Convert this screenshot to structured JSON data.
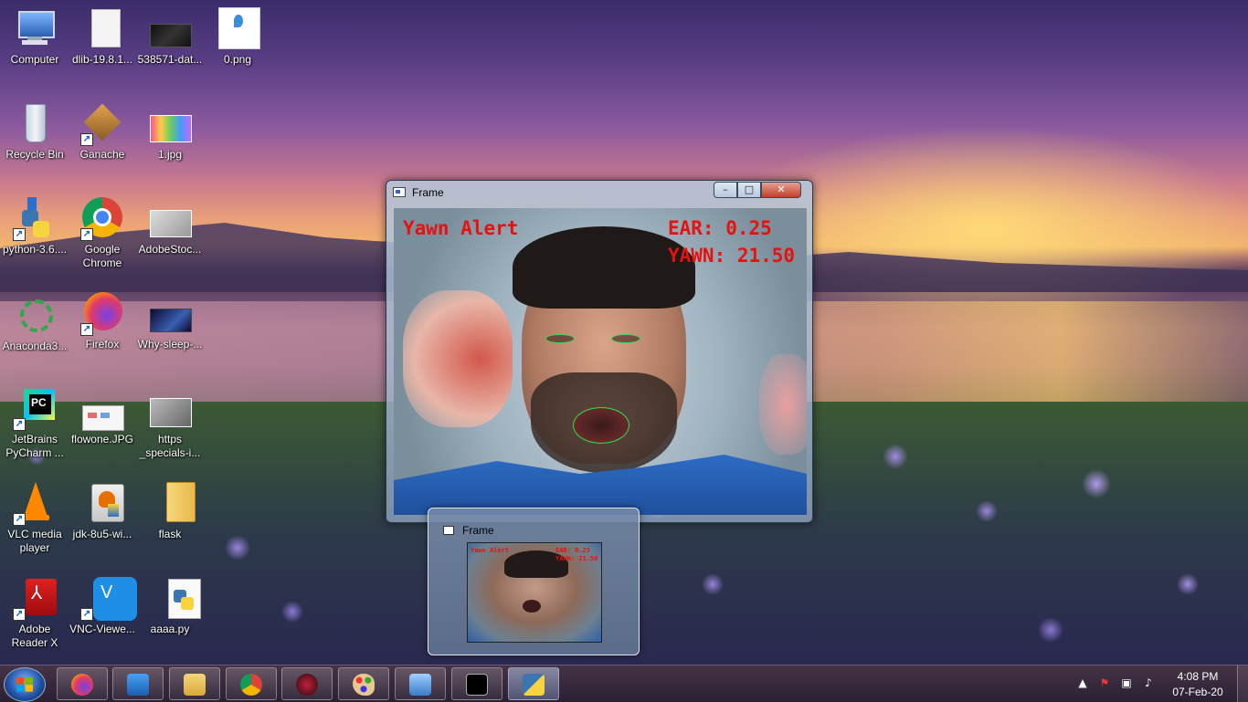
{
  "desktop": {
    "icons": [
      {
        "name": "computer",
        "label": "Computer",
        "icon": "computer-icon"
      },
      {
        "name": "dlib",
        "label": "dlib-19.8.1...",
        "icon": "blank-file-icon"
      },
      {
        "name": "dataset",
        "label": "538571-dat...",
        "icon": "image-file-icon"
      },
      {
        "name": "png0",
        "label": "0.png",
        "icon": "image-file-icon"
      },
      {
        "name": "recycle-bin",
        "label": "Recycle Bin",
        "icon": "recycle-bin-icon"
      },
      {
        "name": "ganache",
        "label": "Ganache",
        "icon": "ganache-icon"
      },
      {
        "name": "jpg1",
        "label": "1.jpg",
        "icon": "image-file-icon"
      },
      {
        "name": "python-installer",
        "label": "python-3.6....",
        "icon": "python-installer-icon"
      },
      {
        "name": "google-chrome",
        "label": "Google Chrome",
        "icon": "chrome-icon"
      },
      {
        "name": "adobestock",
        "label": "AdobeStoc...",
        "icon": "image-file-icon"
      },
      {
        "name": "anaconda",
        "label": "Anaconda3...",
        "icon": "anaconda-icon"
      },
      {
        "name": "firefox",
        "label": "Firefox",
        "icon": "firefox-icon"
      },
      {
        "name": "why-sleep",
        "label": "Why-sleep-...",
        "icon": "image-file-icon"
      },
      {
        "name": "pycharm",
        "label": "JetBrains PyCharm ...",
        "icon": "pycharm-icon"
      },
      {
        "name": "flowone",
        "label": "flowone.JPG",
        "icon": "image-file-icon"
      },
      {
        "name": "https-specials",
        "label": "https _specials-i...",
        "icon": "image-file-icon"
      },
      {
        "name": "vlc",
        "label": "VLC media player",
        "icon": "vlc-icon"
      },
      {
        "name": "jdk",
        "label": "jdk-8u5-wi...",
        "icon": "java-installer-icon"
      },
      {
        "name": "flask",
        "label": "flask",
        "icon": "folder-icon"
      },
      {
        "name": "adobe-reader",
        "label": "Adobe Reader X",
        "icon": "adobe-reader-icon"
      },
      {
        "name": "vnc-viewer",
        "label": "VNC-Viewe...",
        "icon": "vnc-icon"
      },
      {
        "name": "aaaa-py",
        "label": "aaaa.py",
        "icon": "python-file-icon"
      }
    ]
  },
  "window": {
    "title": "Frame",
    "minimize": "–",
    "maximize": "□",
    "close": "✕",
    "overlay": {
      "alert": "Yawn Alert",
      "ear": "EAR: 0.25",
      "yawn": "YAWN: 21.50"
    }
  },
  "preview": {
    "title": "Frame",
    "overlay": {
      "alert": "Yawn Alert",
      "ear": "EAR: 0.25",
      "yawn": "YAWN: 21.50"
    }
  },
  "taskbar": {
    "buttons": [
      {
        "name": "firefox",
        "icon": "firefox-icon"
      },
      {
        "name": "media-player",
        "icon": "media-player-icon"
      },
      {
        "name": "file-explorer",
        "icon": "folder-icon"
      },
      {
        "name": "chrome",
        "icon": "chrome-icon"
      },
      {
        "name": "spider-app",
        "icon": "spider-icon"
      },
      {
        "name": "paint",
        "icon": "paint-palette-icon"
      },
      {
        "name": "control-panel",
        "icon": "control-panel-icon"
      },
      {
        "name": "cmd",
        "icon": "terminal-icon"
      },
      {
        "name": "python",
        "icon": "python-icon"
      }
    ],
    "tray": {
      "show_hidden": "▲",
      "time": "4:08 PM",
      "date": "07-Feb-20"
    }
  },
  "colors": {
    "overlay_text": "#e5120e",
    "landmark": "#2fe04a",
    "taskbar_bg": "#2a1e34"
  }
}
